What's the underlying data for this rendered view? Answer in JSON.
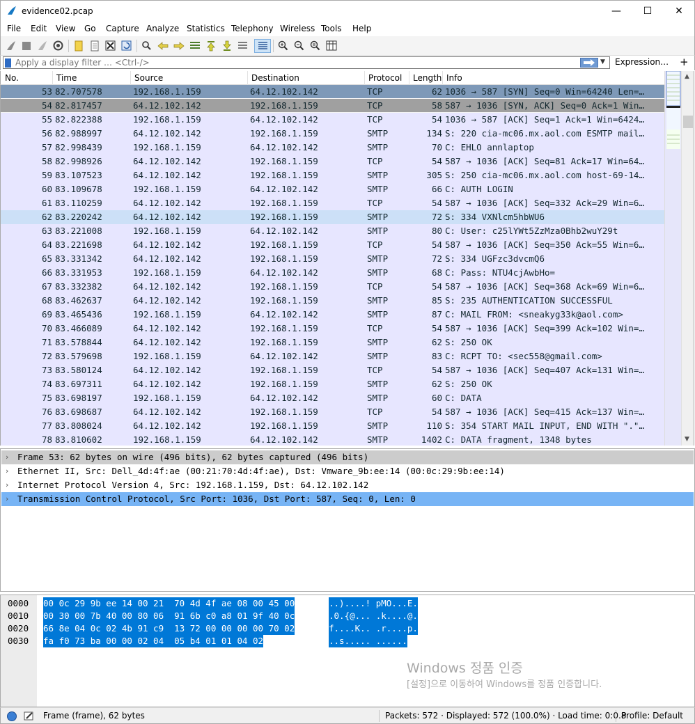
{
  "window": {
    "title": "evidence02.pcap",
    "minimize": "—",
    "maximize": "☐",
    "close": "✕"
  },
  "menu": [
    "File",
    "Edit",
    "View",
    "Go",
    "Capture",
    "Analyze",
    "Statistics",
    "Telephony",
    "Wireless",
    "Tools",
    "Help"
  ],
  "filter": {
    "placeholder": "Apply a display filter … <Ctrl-/>",
    "expression": "Expression…",
    "plus": "+"
  },
  "columns": [
    "No.",
    "Time",
    "Source",
    "Destination",
    "Protocol",
    "Length",
    "Info"
  ],
  "colors": {
    "row_tcp": "#e7e6ff",
    "row_smtp": "#e7e6ff",
    "row_selected": "#7e99b8",
    "row_related": "#a0a0a0",
    "row_hover": "#cce0f7",
    "detail_header": "#cccccc",
    "detail_selected": "#77b4f5",
    "bytes_highlight": "#0078d7"
  },
  "packets": [
    {
      "no": "53",
      "time": "82.707578",
      "src": "192.168.1.159",
      "dst": "64.12.102.142",
      "proto": "TCP",
      "len": "62",
      "info": "1036 → 587 [SYN] Seq=0 Win=64240 Len=…",
      "state": "selected"
    },
    {
      "no": "54",
      "time": "82.817457",
      "src": "64.12.102.142",
      "dst": "192.168.1.159",
      "proto": "TCP",
      "len": "58",
      "info": "587 → 1036 [SYN, ACK] Seq=0 Ack=1 Win…",
      "state": "related"
    },
    {
      "no": "55",
      "time": "82.822388",
      "src": "192.168.1.159",
      "dst": "64.12.102.142",
      "proto": "TCP",
      "len": "54",
      "info": "1036 → 587 [ACK] Seq=1 Ack=1 Win=6424…",
      "state": ""
    },
    {
      "no": "56",
      "time": "82.988997",
      "src": "64.12.102.142",
      "dst": "192.168.1.159",
      "proto": "SMTP",
      "len": "134",
      "info": "S: 220 cia-mc06.mx.aol.com ESMTP mail…",
      "state": ""
    },
    {
      "no": "57",
      "time": "82.998439",
      "src": "192.168.1.159",
      "dst": "64.12.102.142",
      "proto": "SMTP",
      "len": "70",
      "info": "C: EHLO annlaptop",
      "state": ""
    },
    {
      "no": "58",
      "time": "82.998926",
      "src": "64.12.102.142",
      "dst": "192.168.1.159",
      "proto": "TCP",
      "len": "54",
      "info": "587 → 1036 [ACK] Seq=81 Ack=17 Win=64…",
      "state": ""
    },
    {
      "no": "59",
      "time": "83.107523",
      "src": "64.12.102.142",
      "dst": "192.168.1.159",
      "proto": "SMTP",
      "len": "305",
      "info": "S: 250 cia-mc06.mx.aol.com host-69-14…",
      "state": ""
    },
    {
      "no": "60",
      "time": "83.109678",
      "src": "192.168.1.159",
      "dst": "64.12.102.142",
      "proto": "SMTP",
      "len": "66",
      "info": "C: AUTH LOGIN",
      "state": ""
    },
    {
      "no": "61",
      "time": "83.110259",
      "src": "64.12.102.142",
      "dst": "192.168.1.159",
      "proto": "TCP",
      "len": "54",
      "info": "587 → 1036 [ACK] Seq=332 Ack=29 Win=6…",
      "state": ""
    },
    {
      "no": "62",
      "time": "83.220242",
      "src": "64.12.102.142",
      "dst": "192.168.1.159",
      "proto": "SMTP",
      "len": "72",
      "info": "S: 334 VXNlcm5hbWU6",
      "state": "hover"
    },
    {
      "no": "63",
      "time": "83.221008",
      "src": "192.168.1.159",
      "dst": "64.12.102.142",
      "proto": "SMTP",
      "len": "80",
      "info": "C: User: c25lYWt5ZzMza0Bhb2wuY29t",
      "state": ""
    },
    {
      "no": "64",
      "time": "83.221698",
      "src": "64.12.102.142",
      "dst": "192.168.1.159",
      "proto": "TCP",
      "len": "54",
      "info": "587 → 1036 [ACK] Seq=350 Ack=55 Win=6…",
      "state": ""
    },
    {
      "no": "65",
      "time": "83.331342",
      "src": "64.12.102.142",
      "dst": "192.168.1.159",
      "proto": "SMTP",
      "len": "72",
      "info": "S: 334 UGFzc3dvcmQ6",
      "state": ""
    },
    {
      "no": "66",
      "time": "83.331953",
      "src": "192.168.1.159",
      "dst": "64.12.102.142",
      "proto": "SMTP",
      "len": "68",
      "info": "C: Pass: NTU4cjAwbHo=",
      "state": ""
    },
    {
      "no": "67",
      "time": "83.332382",
      "src": "64.12.102.142",
      "dst": "192.168.1.159",
      "proto": "TCP",
      "len": "54",
      "info": "587 → 1036 [ACK] Seq=368 Ack=69 Win=6…",
      "state": ""
    },
    {
      "no": "68",
      "time": "83.462637",
      "src": "64.12.102.142",
      "dst": "192.168.1.159",
      "proto": "SMTP",
      "len": "85",
      "info": "S: 235 AUTHENTICATION SUCCESSFUL",
      "state": ""
    },
    {
      "no": "69",
      "time": "83.465436",
      "src": "192.168.1.159",
      "dst": "64.12.102.142",
      "proto": "SMTP",
      "len": "87",
      "info": "C: MAIL FROM: <sneakyg33k@aol.com>",
      "state": ""
    },
    {
      "no": "70",
      "time": "83.466089",
      "src": "64.12.102.142",
      "dst": "192.168.1.159",
      "proto": "TCP",
      "len": "54",
      "info": "587 → 1036 [ACK] Seq=399 Ack=102 Win=…",
      "state": ""
    },
    {
      "no": "71",
      "time": "83.578844",
      "src": "64.12.102.142",
      "dst": "192.168.1.159",
      "proto": "SMTP",
      "len": "62",
      "info": "S: 250 OK",
      "state": ""
    },
    {
      "no": "72",
      "time": "83.579698",
      "src": "192.168.1.159",
      "dst": "64.12.102.142",
      "proto": "SMTP",
      "len": "83",
      "info": "C: RCPT TO: <sec558@gmail.com>",
      "state": ""
    },
    {
      "no": "73",
      "time": "83.580124",
      "src": "64.12.102.142",
      "dst": "192.168.1.159",
      "proto": "TCP",
      "len": "54",
      "info": "587 → 1036 [ACK] Seq=407 Ack=131 Win=…",
      "state": ""
    },
    {
      "no": "74",
      "time": "83.697311",
      "src": "64.12.102.142",
      "dst": "192.168.1.159",
      "proto": "SMTP",
      "len": "62",
      "info": "S: 250 OK",
      "state": ""
    },
    {
      "no": "75",
      "time": "83.698197",
      "src": "192.168.1.159",
      "dst": "64.12.102.142",
      "proto": "SMTP",
      "len": "60",
      "info": "C: DATA",
      "state": ""
    },
    {
      "no": "76",
      "time": "83.698687",
      "src": "64.12.102.142",
      "dst": "192.168.1.159",
      "proto": "TCP",
      "len": "54",
      "info": "587 → 1036 [ACK] Seq=415 Ack=137 Win=…",
      "state": ""
    },
    {
      "no": "77",
      "time": "83.808024",
      "src": "64.12.102.142",
      "dst": "192.168.1.159",
      "proto": "SMTP",
      "len": "110",
      "info": "S: 354 START MAIL INPUT, END WITH \".\"…",
      "state": ""
    },
    {
      "no": "78",
      "time": "83.810602",
      "src": "192.168.1.159",
      "dst": "64.12.102.142",
      "proto": "SMTP",
      "len": "1402",
      "info": "C: DATA fragment, 1348 bytes",
      "state": ""
    }
  ],
  "details": [
    {
      "text": "Frame 53: 62 bytes on wire (496 bits), 62 bytes captured (496 bits)",
      "state": "header"
    },
    {
      "text": "Ethernet II, Src: Dell_4d:4f:ae (00:21:70:4d:4f:ae), Dst: Vmware_9b:ee:14 (00:0c:29:9b:ee:14)",
      "state": ""
    },
    {
      "text": "Internet Protocol Version 4, Src: 192.168.1.159, Dst: 64.12.102.142",
      "state": ""
    },
    {
      "text": "Transmission Control Protocol, Src Port: 1036, Dst Port: 587, Seq: 0, Len: 0",
      "state": "selected"
    }
  ],
  "bytes": [
    {
      "offset": "0000",
      "hex": "00 0c 29 9b ee 14 00 21  70 4d 4f ae 08 00 45 00",
      "ascii": "..)....! pMO...E."
    },
    {
      "offset": "0010",
      "hex": "00 30 00 7b 40 00 80 06  91 6b c0 a8 01 9f 40 0c",
      "ascii": ".0.{@... .k....@."
    },
    {
      "offset": "0020",
      "hex": "66 8e 04 0c 02 4b 91 c9  13 72 00 00 00 00 70 02",
      "ascii": "f....K.. .r....p."
    },
    {
      "offset": "0030",
      "hex": "fa f0 73 ba 00 00 02 04  05 b4 01 01 04 02",
      "ascii": "..s..... ......"
    }
  ],
  "watermark": {
    "line1": "Windows 정품 인증",
    "line2": "[설정]으로 이동하여 Windows를 정품 인증합니다."
  },
  "status": {
    "frame": "Frame (frame), 62 bytes",
    "packets": "Packets: 572 · Displayed: 572 (100.0%) · Load time: 0:0.8",
    "profile": "Profile: Default"
  }
}
